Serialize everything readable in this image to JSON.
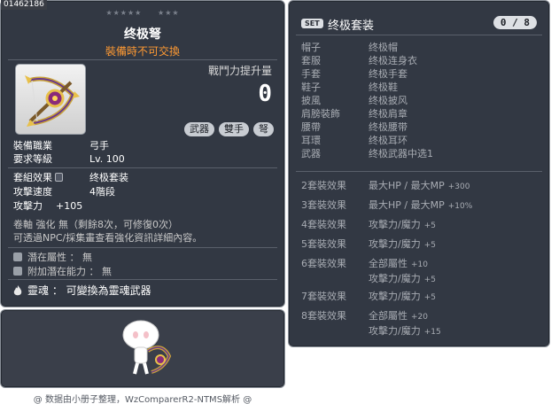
{
  "item_id": "01462186",
  "item": {
    "stars_left": "★★★★★",
    "stars_right": "★★★",
    "title": "终极弩",
    "trade_note": "裝備時不可交換",
    "power_label": "戰鬥力提升量",
    "power_value": "0",
    "tags": [
      "武器",
      "雙手",
      "弩"
    ],
    "rows": [
      {
        "k": "裝備職業",
        "v": "弓手"
      },
      {
        "k": "要求等級",
        "v": "Lv. 100"
      }
    ],
    "stats": [
      {
        "k": "套組效果",
        "v": "终极套装"
      },
      {
        "k": "攻擊速度",
        "v": "4階段"
      },
      {
        "k": "攻擊力",
        "v": "+105"
      }
    ],
    "enhance_line": "卷軸 強化 無（剩餘8次，可修復0次）",
    "info_line": "可透過NPC/採集畫查看強化資訊詳細內容。",
    "potential": "潛在屬性 ： 無",
    "bonus_potential": "附加潛在能力 ： 無",
    "soul_label": "靈魂",
    "soul_text": "： 可變換為靈魂武器"
  },
  "set": {
    "badge": "SET",
    "title": "终极套装",
    "count": "0 / 8",
    "parts": [
      {
        "k": "帽子",
        "v": "终极帽"
      },
      {
        "k": "套服",
        "v": "终极连身衣"
      },
      {
        "k": "手套",
        "v": "终极手套"
      },
      {
        "k": "鞋子",
        "v": "终极鞋"
      },
      {
        "k": "披風",
        "v": "终极披风"
      },
      {
        "k": "肩膀裝飾",
        "v": "终极肩章"
      },
      {
        "k": "腰帶",
        "v": "终极腰带"
      },
      {
        "k": "耳環",
        "v": "终极耳环"
      },
      {
        "k": "武器",
        "v": "终极武器中选1"
      }
    ],
    "bonuses": [
      {
        "k": "2套裝效果",
        "lines": [
          {
            "t": "最大HP / 最大MP",
            "n": "+300"
          }
        ]
      },
      {
        "k": "3套裝效果",
        "lines": [
          {
            "t": "最大HP / 最大MP",
            "n": "+10%"
          }
        ]
      },
      {
        "k": "4套裝效果",
        "lines": [
          {
            "t": "攻擊力/魔力",
            "n": "+5"
          }
        ]
      },
      {
        "k": "5套裝效果",
        "lines": [
          {
            "t": "攻擊力/魔力",
            "n": "+5"
          }
        ]
      },
      {
        "k": "6套裝效果",
        "lines": [
          {
            "t": "全部屬性",
            "n": "+10"
          },
          {
            "t": "攻擊力/魔力",
            "n": "+5"
          }
        ]
      },
      {
        "k": "7套裝效果",
        "lines": [
          {
            "t": "攻擊力/魔力",
            "n": "+5"
          }
        ]
      },
      {
        "k": "8套裝效果",
        "lines": [
          {
            "t": "全部屬性",
            "n": "+20"
          },
          {
            "t": "攻擊力/魔力",
            "n": "+15"
          }
        ]
      }
    ]
  },
  "footer": "@ 数据由小册子整理，WzComparerR2-NTMS解析 @"
}
